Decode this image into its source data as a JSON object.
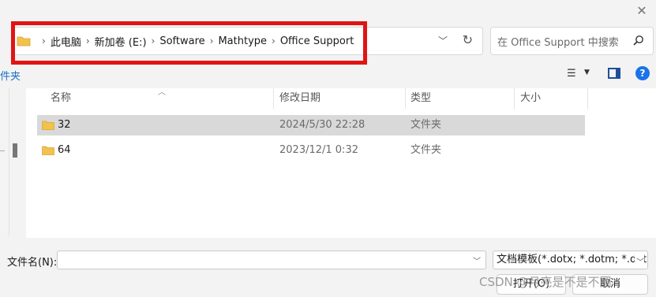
{
  "breadcrumb": [
    "此电脑",
    "新加卷 (E:)",
    "Software",
    "Mathtype",
    "Office Support"
  ],
  "search": {
    "placeholder": "在 Office Support 中搜索"
  },
  "toolbar": {
    "left_fragment": "件夹"
  },
  "columns": {
    "name": "名称",
    "date": "修改日期",
    "type": "类型",
    "size": "大小"
  },
  "rows": [
    {
      "name": "32",
      "date": "2024/5/30 22:28",
      "type": "文件夹",
      "selected": true
    },
    {
      "name": "64",
      "date": "2023/12/1 0:32",
      "type": "文件夹",
      "selected": false
    }
  ],
  "bottom": {
    "filename_label": "文件名(N):",
    "filename_value": "",
    "filetype_value": "文档模板(*.dotx; *.dotm; *.dot",
    "open_label": "打开(O)",
    "cancel_label": "取消"
  },
  "watermark": "CSDN @月亮是不是不圆",
  "colors": {
    "highlight": "#e11414",
    "accent": "#1a73e8",
    "folder": "#f2c14e",
    "selected_row": "#d9d9d9"
  },
  "icons": [
    "folder-icon",
    "search-icon",
    "refresh-icon",
    "chevron-down-icon",
    "view-icon",
    "preview-pane-icon",
    "help-icon",
    "close-icon"
  ]
}
